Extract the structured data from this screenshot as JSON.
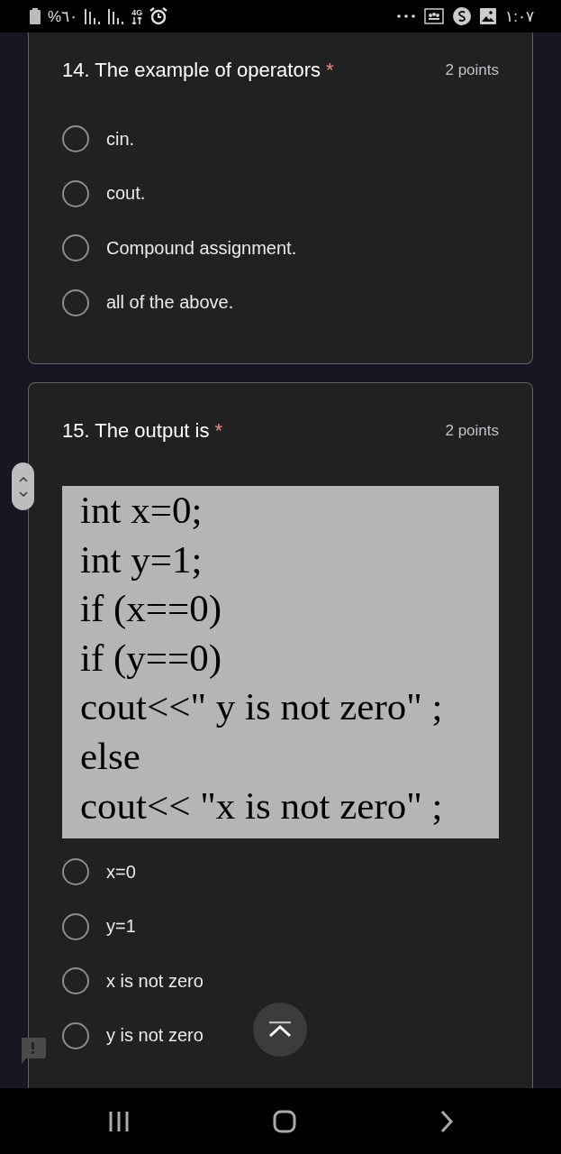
{
  "status_bar": {
    "battery_text": "%٦٠",
    "network": "4G",
    "time": "١:٠٧"
  },
  "questions": [
    {
      "title": "14. The example of operators",
      "required_mark": "*",
      "points": "2 points",
      "options": [
        {
          "label": "cin.",
          "selected": false
        },
        {
          "label": "cout.",
          "selected": false
        },
        {
          "label": "Compound assignment.",
          "selected": false
        },
        {
          "label": "all of the above.",
          "selected": false
        }
      ]
    },
    {
      "title": "15. The output is",
      "required_mark": "*",
      "points": "2 points",
      "code_lines": [
        "int x=0;",
        "int y=1;",
        "if (x==0)",
        "if (y==0)",
        "cout<<\" y is not zero\" ;",
        "else",
        "cout<< \"x is not zero\" ;"
      ],
      "options": [
        {
          "label": "x=0",
          "selected": false
        },
        {
          "label": "y=1",
          "selected": false
        },
        {
          "label": "x is not zero",
          "selected": false
        },
        {
          "label": "y is not zero",
          "selected": false
        }
      ]
    }
  ]
}
